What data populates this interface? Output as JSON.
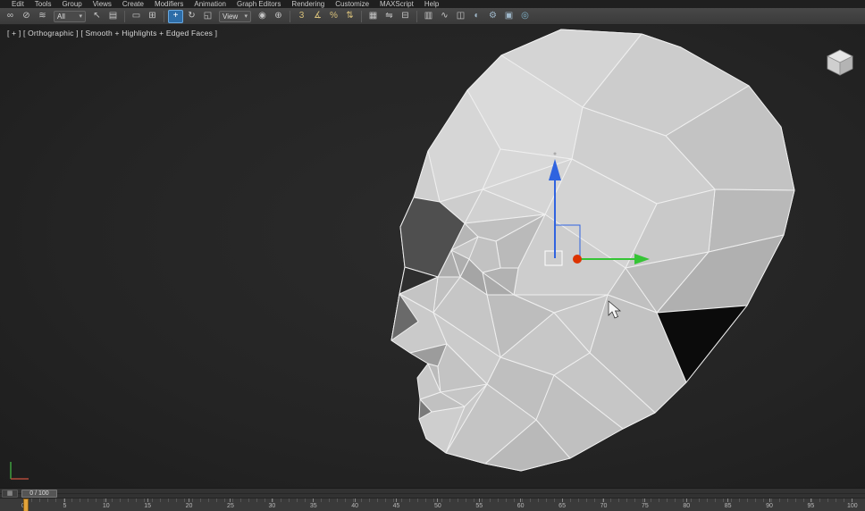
{
  "menu_bar": {
    "items": [
      "Edit",
      "Tools",
      "Group",
      "Views",
      "Create",
      "Modifiers",
      "Animation",
      "Graph Editors",
      "Rendering",
      "Customize",
      "MAXScript",
      "Help"
    ]
  },
  "toolbar": {
    "selection_filter": "All",
    "coord_system": "View",
    "group1": [
      {
        "name": "select-and-link-icon",
        "glyph": "∞"
      },
      {
        "name": "unlink-selection-icon",
        "glyph": "⊘"
      },
      {
        "name": "bind-to-space-warp-icon",
        "glyph": "≋"
      }
    ],
    "group2": [
      {
        "name": "select-object-icon",
        "glyph": "↖"
      },
      {
        "name": "select-by-name-icon",
        "glyph": "▤"
      },
      {
        "sep": true
      },
      {
        "name": "rectangular-selection-region-icon",
        "glyph": "▭"
      },
      {
        "name": "window-crossing-icon",
        "glyph": "⊞"
      },
      {
        "sep": true
      },
      {
        "name": "select-and-move-icon",
        "glyph": "+",
        "active": true
      },
      {
        "name": "select-and-rotate-icon",
        "glyph": "↻"
      },
      {
        "name": "select-and-uniform-scale-icon",
        "glyph": "◱"
      }
    ],
    "group3": [
      {
        "name": "use-pivot-point-center-icon",
        "glyph": "◉"
      },
      {
        "name": "select-and-manipulate-icon",
        "glyph": "⊕"
      },
      {
        "sep": true
      },
      {
        "name": "snap-toggle-3d-icon",
        "glyph": "3",
        "color": "#d8c07a"
      },
      {
        "name": "angle-snap-toggle-icon",
        "glyph": "∡",
        "color": "#d8c07a"
      },
      {
        "name": "percent-snap-toggle-icon",
        "glyph": "%",
        "color": "#d8c07a"
      },
      {
        "name": "spinner-snap-toggle-icon",
        "glyph": "⇅",
        "color": "#d8c07a"
      },
      {
        "sep": true
      },
      {
        "name": "edit-named-selection-sets-icon",
        "glyph": "▦"
      },
      {
        "name": "mirror-icon",
        "glyph": "⇋"
      },
      {
        "name": "align-icon",
        "glyph": "⊟"
      },
      {
        "sep": true
      },
      {
        "name": "manage-layers-icon",
        "glyph": "▥"
      },
      {
        "name": "curve-editor-icon",
        "glyph": "∿"
      },
      {
        "name": "schematic-view-icon",
        "glyph": "◫"
      },
      {
        "name": "material-editor-icon",
        "glyph": "◐",
        "color": "#9fb7c9"
      },
      {
        "name": "render-setup-icon",
        "glyph": "⚙",
        "color": "#9fb7c9"
      },
      {
        "name": "rendered-frame-window-icon",
        "glyph": "▣",
        "color": "#9fb7c9"
      },
      {
        "name": "render-production-icon",
        "glyph": "◎",
        "color": "#7fb2c9"
      }
    ]
  },
  "viewport": {
    "label": "[ + ] [ Orthographic ] [ Smooth + Highlights + Edged Faces ]",
    "model": "low-poly-head",
    "gizmo": {
      "x_axis": "#35c435",
      "z_axis": "#2f63e0",
      "center": "#dd3300"
    }
  },
  "timeline": {
    "slider_label": "0 / 100",
    "mini_curve_glyph": "▦",
    "marker_color": "#e2a33b",
    "ticks": [
      "0",
      "5",
      "10",
      "15",
      "20",
      "25",
      "30",
      "35",
      "40",
      "45",
      "50",
      "55",
      "60",
      "65",
      "70",
      "75",
      "80",
      "85",
      "90",
      "95",
      "100"
    ]
  },
  "colors": {
    "active_tool_highlight": "#2d6da8",
    "viewport_background": "#262626",
    "model_edge": "#efefef"
  }
}
